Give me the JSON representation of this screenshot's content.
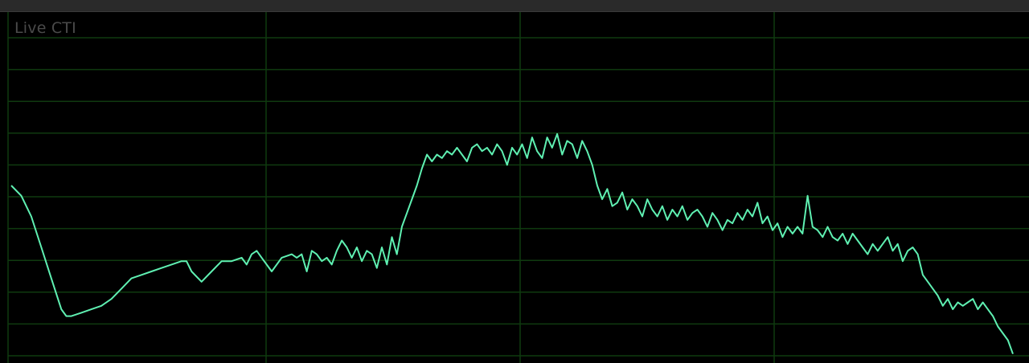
{
  "panel": {
    "title": "Live CTI"
  },
  "colors": {
    "background": "#000000",
    "grid": "#0f3a0f",
    "trace": "#5ff0b2",
    "title": "#4a4a4a"
  },
  "chart_data": {
    "type": "line",
    "grid": true,
    "xlim": [
      0,
      1
    ],
    "ylim": [
      0,
      1
    ],
    "series": [
      {
        "points": [
          [
            0.0,
            0.5
          ],
          [
            0.01,
            0.47
          ],
          [
            0.02,
            0.41
          ],
          [
            0.03,
            0.32
          ],
          [
            0.04,
            0.23
          ],
          [
            0.05,
            0.14
          ],
          [
            0.055,
            0.12
          ],
          [
            0.06,
            0.12
          ],
          [
            0.07,
            0.13
          ],
          [
            0.08,
            0.14
          ],
          [
            0.09,
            0.15
          ],
          [
            0.1,
            0.17
          ],
          [
            0.11,
            0.2
          ],
          [
            0.12,
            0.23
          ],
          [
            0.13,
            0.24
          ],
          [
            0.14,
            0.25
          ],
          [
            0.15,
            0.26
          ],
          [
            0.16,
            0.27
          ],
          [
            0.17,
            0.28
          ],
          [
            0.175,
            0.28
          ],
          [
            0.18,
            0.25
          ],
          [
            0.19,
            0.22
          ],
          [
            0.2,
            0.25
          ],
          [
            0.21,
            0.28
          ],
          [
            0.22,
            0.28
          ],
          [
            0.23,
            0.29
          ],
          [
            0.235,
            0.27
          ],
          [
            0.24,
            0.3
          ],
          [
            0.245,
            0.31
          ],
          [
            0.25,
            0.29
          ],
          [
            0.26,
            0.25
          ],
          [
            0.27,
            0.29
          ],
          [
            0.28,
            0.3
          ],
          [
            0.285,
            0.29
          ],
          [
            0.29,
            0.3
          ],
          [
            0.295,
            0.25
          ],
          [
            0.3,
            0.31
          ],
          [
            0.305,
            0.3
          ],
          [
            0.31,
            0.28
          ],
          [
            0.315,
            0.29
          ],
          [
            0.32,
            0.27
          ],
          [
            0.325,
            0.31
          ],
          [
            0.33,
            0.34
          ],
          [
            0.335,
            0.32
          ],
          [
            0.34,
            0.29
          ],
          [
            0.345,
            0.32
          ],
          [
            0.35,
            0.28
          ],
          [
            0.355,
            0.31
          ],
          [
            0.36,
            0.3
          ],
          [
            0.365,
            0.26
          ],
          [
            0.37,
            0.32
          ],
          [
            0.375,
            0.27
          ],
          [
            0.38,
            0.35
          ],
          [
            0.385,
            0.3
          ],
          [
            0.39,
            0.38
          ],
          [
            0.395,
            0.42
          ],
          [
            0.4,
            0.46
          ],
          [
            0.405,
            0.5
          ],
          [
            0.41,
            0.55
          ],
          [
            0.415,
            0.59
          ],
          [
            0.42,
            0.57
          ],
          [
            0.425,
            0.59
          ],
          [
            0.43,
            0.58
          ],
          [
            0.435,
            0.6
          ],
          [
            0.44,
            0.59
          ],
          [
            0.445,
            0.61
          ],
          [
            0.45,
            0.59
          ],
          [
            0.455,
            0.57
          ],
          [
            0.46,
            0.61
          ],
          [
            0.465,
            0.62
          ],
          [
            0.47,
            0.6
          ],
          [
            0.475,
            0.61
          ],
          [
            0.48,
            0.59
          ],
          [
            0.485,
            0.62
          ],
          [
            0.49,
            0.6
          ],
          [
            0.495,
            0.56
          ],
          [
            0.5,
            0.61
          ],
          [
            0.505,
            0.59
          ],
          [
            0.51,
            0.62
          ],
          [
            0.515,
            0.58
          ],
          [
            0.52,
            0.64
          ],
          [
            0.525,
            0.6
          ],
          [
            0.53,
            0.58
          ],
          [
            0.535,
            0.64
          ],
          [
            0.54,
            0.61
          ],
          [
            0.545,
            0.65
          ],
          [
            0.55,
            0.59
          ],
          [
            0.555,
            0.63
          ],
          [
            0.56,
            0.62
          ],
          [
            0.565,
            0.58
          ],
          [
            0.57,
            0.63
          ],
          [
            0.575,
            0.6
          ],
          [
            0.58,
            0.56
          ],
          [
            0.585,
            0.5
          ],
          [
            0.59,
            0.46
          ],
          [
            0.595,
            0.49
          ],
          [
            0.6,
            0.44
          ],
          [
            0.605,
            0.45
          ],
          [
            0.61,
            0.48
          ],
          [
            0.615,
            0.43
          ],
          [
            0.62,
            0.46
          ],
          [
            0.625,
            0.44
          ],
          [
            0.63,
            0.41
          ],
          [
            0.635,
            0.46
          ],
          [
            0.64,
            0.43
          ],
          [
            0.645,
            0.41
          ],
          [
            0.65,
            0.44
          ],
          [
            0.655,
            0.4
          ],
          [
            0.66,
            0.43
          ],
          [
            0.665,
            0.41
          ],
          [
            0.67,
            0.44
          ],
          [
            0.675,
            0.4
          ],
          [
            0.68,
            0.42
          ],
          [
            0.685,
            0.43
          ],
          [
            0.69,
            0.41
          ],
          [
            0.695,
            0.38
          ],
          [
            0.7,
            0.42
          ],
          [
            0.705,
            0.4
          ],
          [
            0.71,
            0.37
          ],
          [
            0.715,
            0.4
          ],
          [
            0.72,
            0.39
          ],
          [
            0.725,
            0.42
          ],
          [
            0.73,
            0.4
          ],
          [
            0.735,
            0.43
          ],
          [
            0.74,
            0.41
          ],
          [
            0.745,
            0.45
          ],
          [
            0.75,
            0.39
          ],
          [
            0.755,
            0.41
          ],
          [
            0.76,
            0.37
          ],
          [
            0.765,
            0.39
          ],
          [
            0.77,
            0.35
          ],
          [
            0.775,
            0.38
          ],
          [
            0.78,
            0.36
          ],
          [
            0.785,
            0.38
          ],
          [
            0.79,
            0.36
          ],
          [
            0.795,
            0.47
          ],
          [
            0.8,
            0.38
          ],
          [
            0.805,
            0.37
          ],
          [
            0.81,
            0.35
          ],
          [
            0.815,
            0.38
          ],
          [
            0.82,
            0.35
          ],
          [
            0.825,
            0.34
          ],
          [
            0.83,
            0.36
          ],
          [
            0.835,
            0.33
          ],
          [
            0.84,
            0.36
          ],
          [
            0.845,
            0.34
          ],
          [
            0.85,
            0.32
          ],
          [
            0.855,
            0.3
          ],
          [
            0.86,
            0.33
          ],
          [
            0.865,
            0.31
          ],
          [
            0.87,
            0.33
          ],
          [
            0.875,
            0.35
          ],
          [
            0.88,
            0.31
          ],
          [
            0.885,
            0.33
          ],
          [
            0.89,
            0.28
          ],
          [
            0.895,
            0.31
          ],
          [
            0.9,
            0.32
          ],
          [
            0.905,
            0.3
          ],
          [
            0.91,
            0.24
          ],
          [
            0.915,
            0.22
          ],
          [
            0.92,
            0.2
          ],
          [
            0.925,
            0.18
          ],
          [
            0.93,
            0.15
          ],
          [
            0.935,
            0.17
          ],
          [
            0.94,
            0.14
          ],
          [
            0.945,
            0.16
          ],
          [
            0.95,
            0.15
          ],
          [
            0.955,
            0.16
          ],
          [
            0.96,
            0.17
          ],
          [
            0.965,
            0.14
          ],
          [
            0.97,
            0.16
          ],
          [
            0.975,
            0.14
          ],
          [
            0.98,
            0.12
          ],
          [
            0.985,
            0.09
          ],
          [
            0.99,
            0.07
          ],
          [
            0.995,
            0.05
          ],
          [
            1.0,
            0.01
          ]
        ]
      }
    ]
  }
}
